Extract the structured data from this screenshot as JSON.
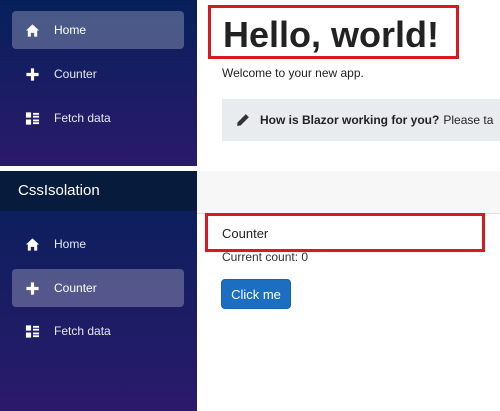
{
  "top": {
    "sidebar": {
      "items": [
        {
          "label": "Home",
          "icon": "home-icon",
          "active": true
        },
        {
          "label": "Counter",
          "icon": "plus-icon",
          "active": false
        },
        {
          "label": "Fetch data",
          "icon": "list-icon",
          "active": false
        }
      ]
    },
    "main": {
      "heading": "Hello, world!",
      "welcome": "Welcome to your new app.",
      "survey_bold": "How is Blazor working for you?",
      "survey_rest": "Please ta",
      "survey_icon": "pencil-icon"
    }
  },
  "bottom": {
    "app_title": "CssIsolation",
    "sidebar": {
      "items": [
        {
          "label": "Home",
          "icon": "home-icon",
          "active": false
        },
        {
          "label": "Counter",
          "icon": "plus-icon",
          "active": true
        },
        {
          "label": "Fetch data",
          "icon": "list-icon",
          "active": false
        }
      ]
    },
    "main": {
      "title": "Counter",
      "count_text": "Current count: 0",
      "button_label": "Click me"
    }
  },
  "colors": {
    "highlight_border": "#d71920",
    "sidebar_top": "#06205b",
    "sidebar_bottom": "#2b1a6b",
    "button_blue": "#1b6ec2"
  }
}
